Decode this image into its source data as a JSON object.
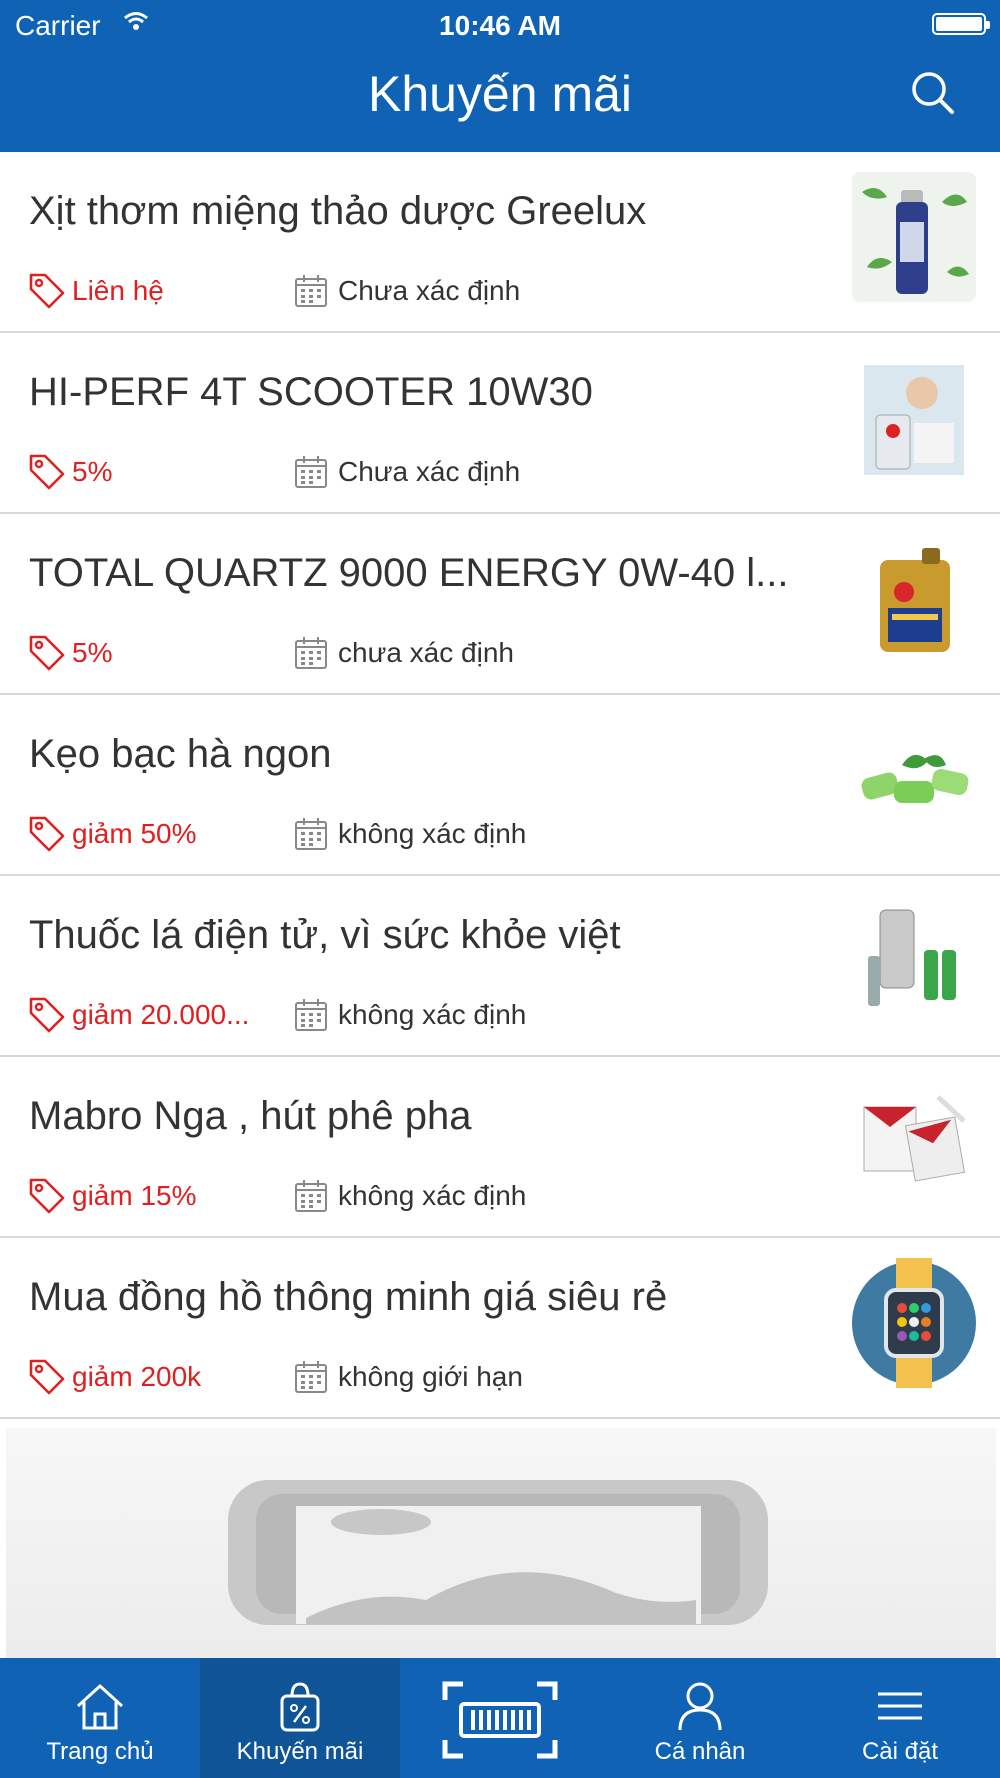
{
  "status_bar": {
    "carrier": "Carrier",
    "time": "10:46 AM"
  },
  "header": {
    "title": "Khuyến mãi",
    "search_icon": "search-icon"
  },
  "promotions": [
    {
      "title": "Xịt thơm miệng thảo dược Greelux",
      "discount": "Liên hệ",
      "date": "Chưa xác định"
    },
    {
      "title": "HI-PERF 4T SCOOTER 10W30",
      "discount": "5%",
      "date": "Chưa xác định"
    },
    {
      "title": "TOTAL QUARTZ 9000 ENERGY 0W-40 l...",
      "discount": "5%",
      "date": "chưa xác định"
    },
    {
      "title": "Kẹo bạc hà ngon",
      "discount": "giảm 50%",
      "date": "không xác định"
    },
    {
      "title": "Thuốc lá điện tử, vì sức khỏe việt",
      "discount": "giảm 20.000...",
      "date": "không xác định"
    },
    {
      "title": "Mabro Nga , hút phê pha",
      "discount": "giảm 15%",
      "date": "không xác định"
    },
    {
      "title": "Mua đồng hồ thông minh giá siêu rẻ",
      "discount": "giảm 200k",
      "date": "không giới hạn"
    }
  ],
  "tabs": [
    {
      "label": "Trang chủ",
      "icon": "home-icon"
    },
    {
      "label": "Khuyến mãi",
      "icon": "shopping-bag-percent-icon"
    },
    {
      "label": "",
      "icon": "barcode-scanner-icon"
    },
    {
      "label": "Cá nhân",
      "icon": "user-icon"
    },
    {
      "label": "Cài đặt",
      "icon": "menu-icon"
    }
  ],
  "colors": {
    "primary": "#1063b4",
    "active_tab": "#0f5496",
    "discount_red": "#e02020",
    "text": "#333333"
  }
}
